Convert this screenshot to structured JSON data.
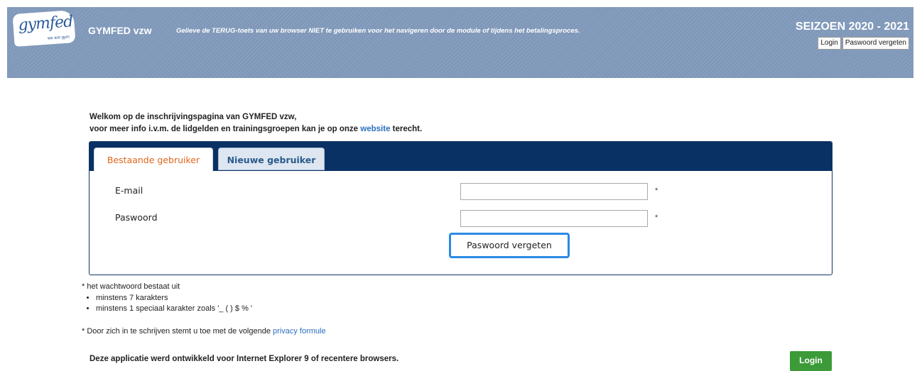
{
  "header": {
    "logo_text": "gymfed",
    "logo_tagline": "we are gym",
    "brand": "GYMFED vzw",
    "notice": "Gelieve de TERUG-toets van uw browser NIET te gebruiken voor het navigeren door de module of tijdens het betalingsproces.",
    "season": "SEIZOEN 2020 - 2021",
    "login_label": "Login",
    "forgot_label": "Paswoord vergeten",
    "colors": {
      "bar": "#7f98b9"
    }
  },
  "welcome": {
    "line1": "Welkom op de inschrijvingspagina van GYMFED vzw,",
    "line2_before": "voor meer info i.v.m. de lidgelden en trainingsgroepen kan je op onze ",
    "line2_link": "website",
    "line2_after": " terecht."
  },
  "tabs": {
    "existing": "Bestaande gebruiker",
    "new": "Nieuwe gebruiker",
    "active": "Bestaande gebruiker"
  },
  "form": {
    "email_label": "E-mail",
    "email_value": "",
    "password_label": "Paswoord",
    "password_value": "",
    "required_marker": "*",
    "forgot_button": "Paswoord vergeten"
  },
  "password_rules": {
    "intro": "* het wachtwoord bestaat uit",
    "items": [
      "minstens 7 karakters",
      "minstens 1 speciaal karakter zoals '_ ( ) $ % '"
    ]
  },
  "privacy": {
    "text": "* Door zich in te schrijven stemt u toe met de volgende ",
    "link": "privacy formule"
  },
  "footer": {
    "browser_note": "Deze applicatie werd ontwikkeld voor Internet Explorer 9 of recentere browsers.",
    "login_button": "Login"
  },
  "colors": {
    "tabbar": "#0a3163",
    "active_tab_text": "#e0661c",
    "highlight_border": "#2b8ae4",
    "login_button": "#3c9b38",
    "link": "#2a6fbf"
  }
}
